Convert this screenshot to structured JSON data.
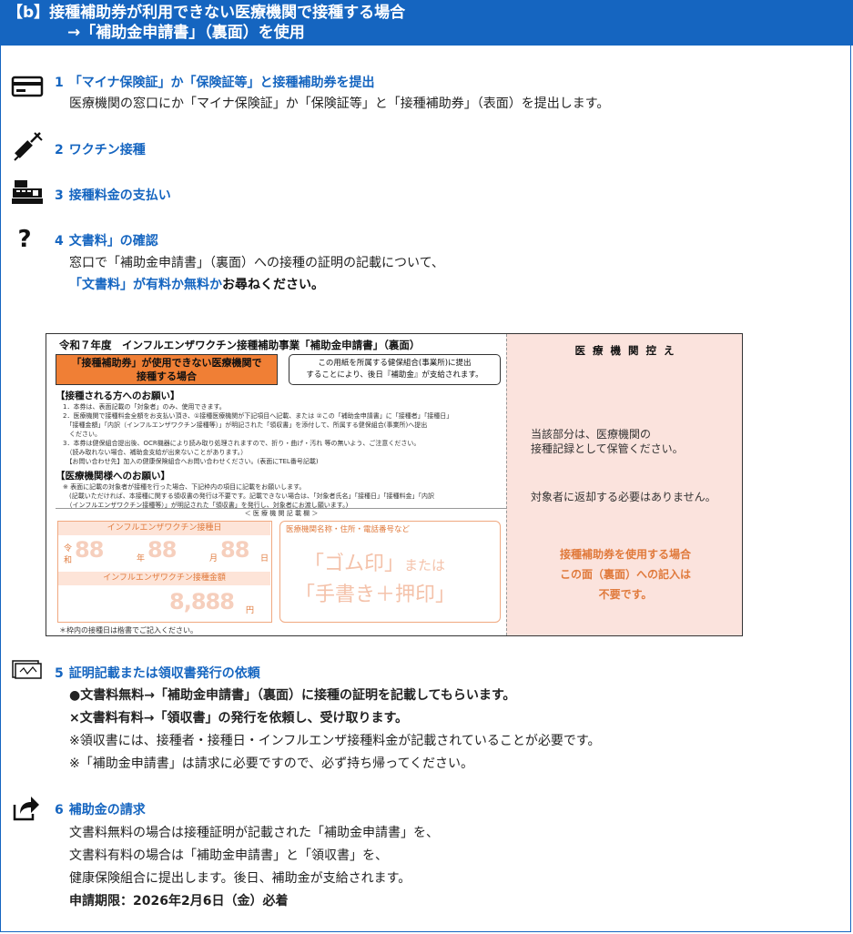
{
  "banner": {
    "line1": "【b】接種補助券が利用できない医療機関で接種する場合",
    "line2": "→「補助金申請書」（裏面）を使用"
  },
  "steps": [
    {
      "num": "1",
      "icon": "id-card-icon",
      "title": "「マイナ保険証」か「保険証等」と接種補助券を提出",
      "lines": [
        "医療機関の窓口にか「マイナ保険証」か「保険証等」と「接種補助券」（表面）を提出します。"
      ]
    },
    {
      "num": "2",
      "icon": "syringe-icon",
      "title": "ワクチン接種"
    },
    {
      "num": "3",
      "icon": "cash-register-icon",
      "title": "接種料金の支払い"
    },
    {
      "num": "4",
      "icon": "question-icon",
      "title": "文書料」の確認",
      "line1": "窓口で「補助金申請書」（裏面）への接種の証明の記載について、",
      "line2_blue": "「文書料」が有料か無料か",
      "line2_black": "お尋ねください。"
    },
    {
      "num": "5",
      "icon": "certificate-icon",
      "title": "証明記載または領収書発行の依頼",
      "lines": [
        "●文書料無料→「補助金申請書」（裏面）に接種の証明を記載してもらいます。",
        "×文書料有料→「領収書」の発行を依頼し、受け取ります。",
        "※領収書には、接種者・接種日・インフルエンザ接種料金が記載されていることが必要です。",
        "※「補助金申請書」は請求に必要ですので、必ず持ち帰ってください。"
      ]
    },
    {
      "num": "6",
      "icon": "share-arrow-icon",
      "title": "補助金の請求",
      "lines": [
        "文書料無料の場合は接種証明が記載された「補助金申請書」を、",
        "文書料有料の場合は「補助金申請書」と「領収書」を、",
        "健康保険組合に提出します。後日、補助金が支給されます。",
        "申請期限：2026年2月6日（金）必着"
      ]
    }
  ],
  "form": {
    "title": "令和７年度　インフルエンザワクチン接種補助事業「補助金申請書」（裏面）",
    "orange_box": [
      "「接種補助券」が使用できない医療機関で",
      "接種する場合"
    ],
    "note_box": [
      "この用紙を所属する健保組合(事業所)に提出",
      "することにより、後日『補助金』が支給されます。"
    ],
    "sect1": "【接種される方へのお願い】",
    "sect1_lines": [
      "1．本券は、表面記載の「対象者」のみ、使用できます。",
      "2．医療機関で接種料金全額をお支払い頂き、①接種医療機関が下記項目へ記載、または ②この「補助金申請書」に「接種者」「接種日」",
      "　「接種金額」「内訳（インフルエンザワクチン接種等）」が明記された「領収書」を添付して、所属する健保組合(事業所)へ提出",
      "　ください。",
      "3．本券は健保組合提出後、OCR機器により読み取り処理されますので、折り・曲げ・汚れ 等の無いよう、ご注意ください。",
      "　（読み取れない場合、補助金支給が出来ないことがあります。）",
      "　【お問い合わせ先】加入の健康保険組合へお問い合わせください。(表面にTEL番号記載)"
    ],
    "sect2": "【医療機関様へのお願い】",
    "sect2_lines": [
      "※ 表面に記載の対象者が接種を行った場合、下記枠内の項目に記載をお願いします。",
      "　(記載いただければ、本接種に関する領収書の発行は不要です。記載できない場合は、「対象者氏名」「接種日」「接種料金」「内訳",
      "　（インフルエンザワクチン接種等）」が明記された「領収書」を発行し、対象者にお渡し願います。)"
    ],
    "divider": "＜ 医 療 機 関 記 載 欄 ＞",
    "date_header": "インフルエンザワクチン接種日",
    "era": "令",
    "era2": "和",
    "date_digits": [
      "88",
      "88",
      "88"
    ],
    "date_units": [
      "年",
      "月",
      "日"
    ],
    "amount_header": "インフルエンザワクチン接種金額",
    "amount_digits": "8,888",
    "amount_unit": "円",
    "stamp_label": "医療機関名称・住所・電話番号など",
    "stamp_line1a": "「ゴム印」",
    "stamp_line1b": "または",
    "stamp_line2": "「手書き＋押印」",
    "footnote": "＊枠内の接種日は楷書でご記入ください。",
    "right_title": "医 療 機 関 控 え",
    "right_t1": "当該部分は、医療機関の",
    "right_t2": "接種記録として保管ください。",
    "right_t3": "対象者に返却する必要はありません。",
    "right_o": [
      "接種補助券を使用する場合",
      "この面（裏面）への記入は",
      "不要です。"
    ]
  },
  "colors": {
    "brand_blue": "#1565c0",
    "form_orange": "#f07f35",
    "pink_pane": "#fbe3dd"
  }
}
